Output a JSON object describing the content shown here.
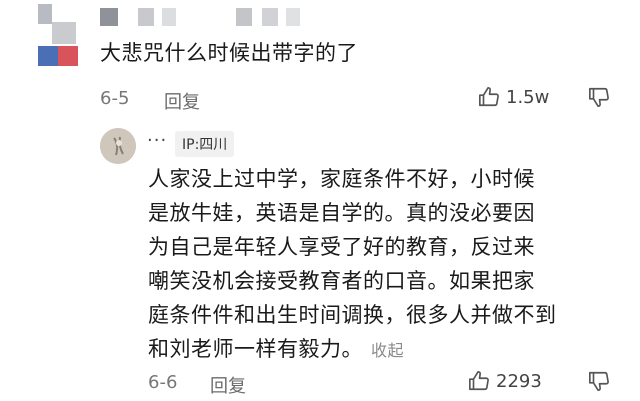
{
  "top_comment": {
    "text": "大悲咒什么时候出带字的了",
    "date": "6-5",
    "reply_label": "回复",
    "likes": "1.5w",
    "avatar_colors": [
      "#9aa0a6",
      "#4a6fb5",
      "#d9535a",
      "#c2c4c7"
    ]
  },
  "reply_comment": {
    "dots": "···",
    "ip": "IP:四川",
    "lines": [
      "人家没上过中学，家庭条件不好，小时候",
      "是放牛娃，英语是自学的。真的没必要因",
      "为自己是年轻人享受了好的教育，反过来",
      "嘲笑没机会接受教育者的口音。如果把家",
      "庭条件件和出生时间调换，很多人并做不到",
      "和刘老师一样有毅力。"
    ],
    "collapse_label": "收起",
    "date": "6-6",
    "reply_label": "回复",
    "likes": "2293"
  },
  "icons": {
    "like": "thumbs-up-icon",
    "dislike": "thumbs-down-icon"
  }
}
